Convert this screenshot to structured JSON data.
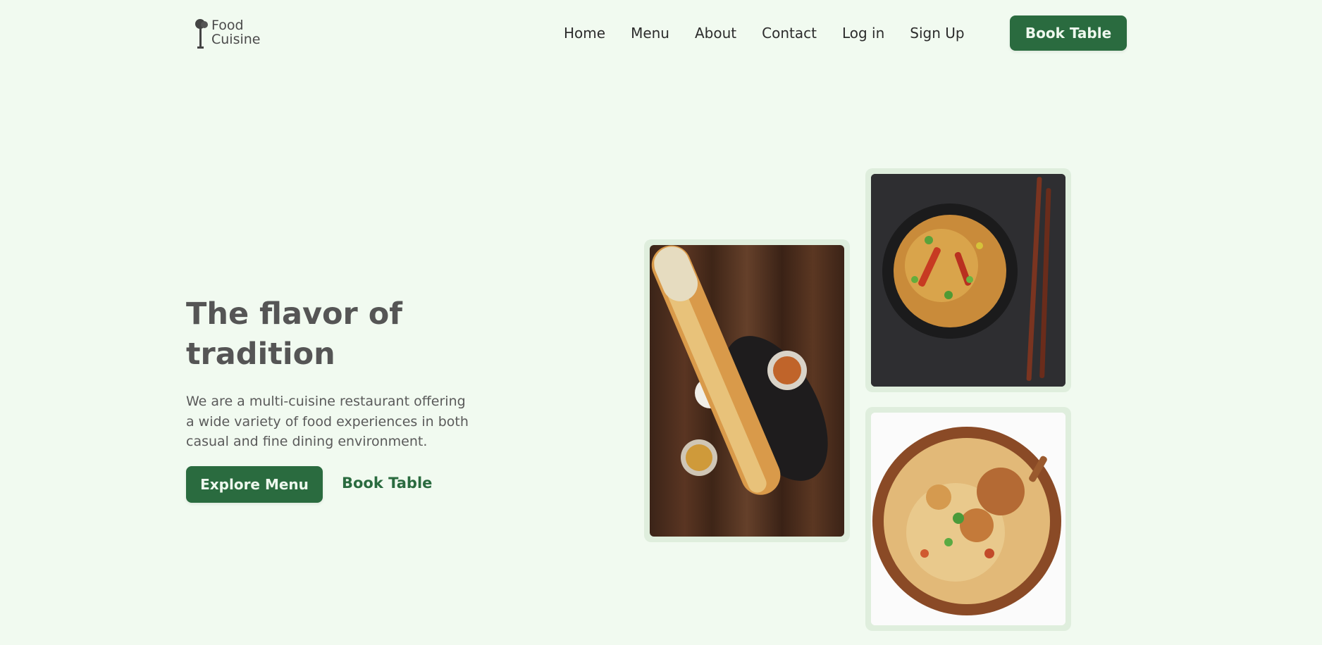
{
  "logo": {
    "line1": "Food",
    "line2": "Cuisine"
  },
  "nav": {
    "items": [
      {
        "label": "Home"
      },
      {
        "label": "Menu"
      },
      {
        "label": "About"
      },
      {
        "label": "Contact"
      },
      {
        "label": "Log in"
      },
      {
        "label": "Sign Up"
      }
    ],
    "cta_label": "Book Table"
  },
  "hero": {
    "title_line1": "The flavor of",
    "title_line2": "tradition",
    "description_lines": [
      "We are a multi-cuisine restaurant offering",
      "a wide variety of food experiences in both",
      "casual and fine dining environment."
    ],
    "primary_button": "Explore Menu",
    "secondary_link": "Book Table"
  },
  "images": [
    {
      "name": "dosa-photo"
    },
    {
      "name": "noodles-photo"
    },
    {
      "name": "biryani-photo"
    }
  ],
  "colors": {
    "background": "#f1faf0",
    "accent": "#2a6b3f",
    "card_frame": "#dfeedd"
  }
}
